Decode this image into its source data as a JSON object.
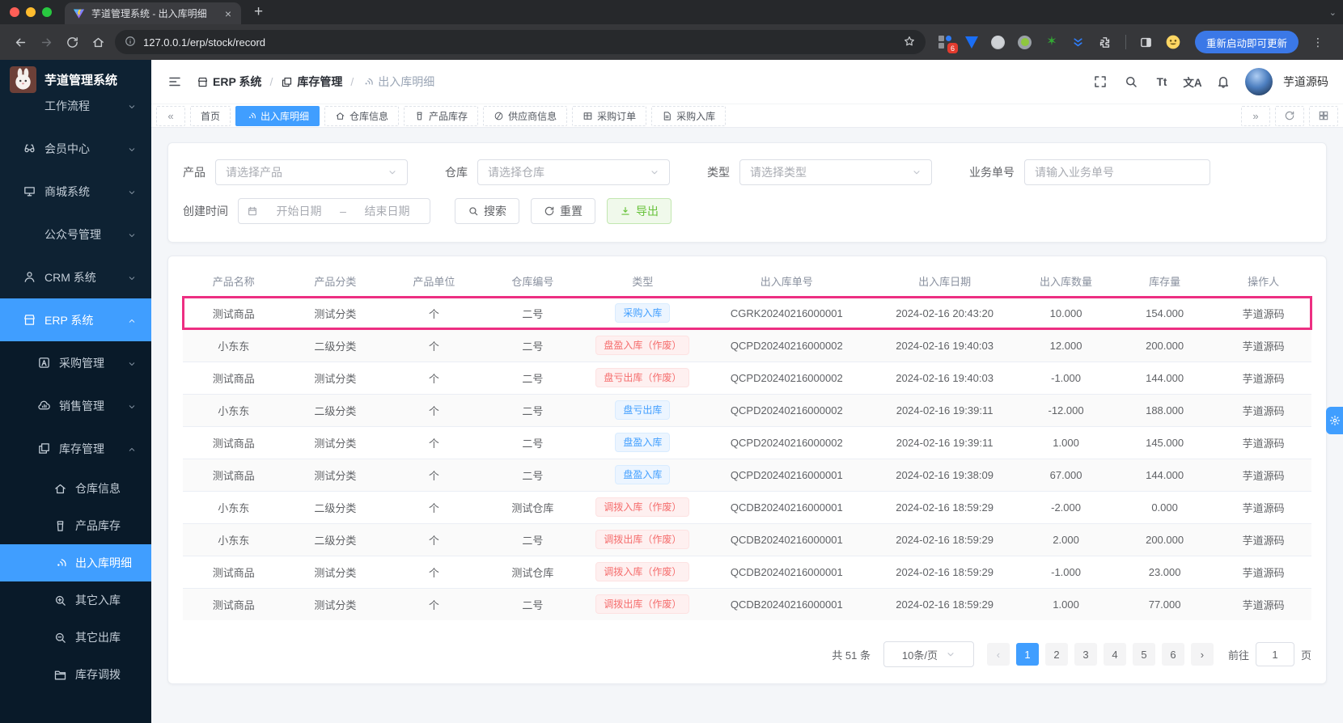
{
  "browser": {
    "tab_title": "芋道管理系统 - 出入库明细",
    "url": "127.0.0.1/erp/stock/record",
    "update_button_label": "重新启动即可更新",
    "extension_badge_count": "6"
  },
  "app_header": {
    "breadcrumb": [
      {
        "label": "ERP 系统",
        "icon": "store-icon"
      },
      {
        "label": "库存管理",
        "icon": "stock-icon"
      },
      {
        "label": "出入库明细",
        "icon": "record-icon"
      }
    ],
    "font_size_icon_text": "Tt",
    "locale_icon_text": "文A",
    "username": "芋道源码"
  },
  "tags_view": {
    "tabs": [
      {
        "label": "首页",
        "icon": null,
        "active": false
      },
      {
        "label": "出入库明细",
        "icon": "record-icon",
        "active": true
      },
      {
        "label": "仓库信息",
        "icon": "home-icon",
        "active": false
      },
      {
        "label": "产品库存",
        "icon": "cup-icon",
        "active": false
      },
      {
        "label": "供应商信息",
        "icon": "supplier-icon",
        "active": false
      },
      {
        "label": "采购订单",
        "icon": "table-icon",
        "active": false
      },
      {
        "label": "采购入库",
        "icon": "document-icon",
        "active": false
      }
    ]
  },
  "sidebar": {
    "title": "芋道管理系统",
    "items": [
      {
        "label": "工作流程",
        "level": 1,
        "chevron": "down",
        "icon": null,
        "clipped": true,
        "active": false
      },
      {
        "label": "会员中心",
        "level": 1,
        "chevron": "down",
        "icon": "member-icon",
        "active": false
      },
      {
        "label": "商城系统",
        "level": 1,
        "chevron": "down",
        "icon": "mall-icon",
        "active": false
      },
      {
        "label": "公众号管理",
        "level": 1,
        "chevron": "down",
        "icon": null,
        "active": false
      },
      {
        "label": "CRM 系统",
        "level": 1,
        "chevron": "down",
        "icon": "user-icon",
        "active": false
      },
      {
        "label": "ERP 系统",
        "level": 1,
        "chevron": "up",
        "icon": "store-icon",
        "active": true
      },
      {
        "label": "采购管理",
        "level": 2,
        "chevron": "down",
        "icon": "a-square-icon",
        "active": false
      },
      {
        "label": "销售管理",
        "level": 2,
        "chevron": "down",
        "icon": "cloud-chart-icon",
        "active": false
      },
      {
        "label": "库存管理",
        "level": 2,
        "chevron": "up",
        "icon": "stock-icon",
        "active": false
      },
      {
        "label": "仓库信息",
        "level": 3,
        "chevron": null,
        "icon": "home-icon",
        "active": false
      },
      {
        "label": "产品库存",
        "level": 3,
        "chevron": null,
        "icon": "cup-icon",
        "active": false
      },
      {
        "label": "出入库明细",
        "level": 3,
        "chevron": null,
        "icon": "record-icon",
        "active": true
      },
      {
        "label": "其它入库",
        "level": 3,
        "chevron": null,
        "icon": "zoom-in-icon",
        "active": false
      },
      {
        "label": "其它出库",
        "level": 3,
        "chevron": null,
        "icon": "zoom-out-icon",
        "active": false
      },
      {
        "label": "库存调拨",
        "level": 3,
        "chevron": null,
        "icon": "folder-icon",
        "active": false
      }
    ]
  },
  "filters": {
    "product": {
      "label": "产品",
      "placeholder": "请选择产品"
    },
    "warehouse": {
      "label": "仓库",
      "placeholder": "请选择仓库"
    },
    "type": {
      "label": "类型",
      "placeholder": "请选择类型"
    },
    "biz_no": {
      "label": "业务单号",
      "placeholder": "请输入业务单号"
    },
    "create_time": {
      "label": "创建时间",
      "start_placeholder": "开始日期",
      "separator": "–",
      "end_placeholder": "结束日期"
    },
    "search_label": "搜索",
    "reset_label": "重置",
    "export_label": "导出"
  },
  "table": {
    "columns": [
      "产品名称",
      "产品分类",
      "产品单位",
      "仓库编号",
      "类型",
      "出入库单号",
      "出入库日期",
      "出入库数量",
      "库存量",
      "操作人"
    ],
    "rows": [
      {
        "product": "测试商品",
        "category": "测试分类",
        "unit": "个",
        "warehouse": "二号",
        "type": "采购入库",
        "type_color": "blue",
        "order_no": "CGRK20240216000001",
        "datetime": "2024-02-16 20:43:20",
        "quantity": "10.000",
        "stock": "154.000",
        "operator": "芋道源码",
        "highlighted": true
      },
      {
        "product": "小东东",
        "category": "二级分类",
        "unit": "个",
        "warehouse": "二号",
        "type": "盘盈入库（作废）",
        "type_color": "red",
        "order_no": "QCPD20240216000002",
        "datetime": "2024-02-16 19:40:03",
        "quantity": "12.000",
        "stock": "200.000",
        "operator": "芋道源码",
        "highlighted": false
      },
      {
        "product": "测试商品",
        "category": "测试分类",
        "unit": "个",
        "warehouse": "二号",
        "type": "盘亏出库（作废）",
        "type_color": "red",
        "order_no": "QCPD20240216000002",
        "datetime": "2024-02-16 19:40:03",
        "quantity": "-1.000",
        "stock": "144.000",
        "operator": "芋道源码",
        "highlighted": false
      },
      {
        "product": "小东东",
        "category": "二级分类",
        "unit": "个",
        "warehouse": "二号",
        "type": "盘亏出库",
        "type_color": "blue",
        "order_no": "QCPD20240216000002",
        "datetime": "2024-02-16 19:39:11",
        "quantity": "-12.000",
        "stock": "188.000",
        "operator": "芋道源码",
        "highlighted": false
      },
      {
        "product": "测试商品",
        "category": "测试分类",
        "unit": "个",
        "warehouse": "二号",
        "type": "盘盈入库",
        "type_color": "blue",
        "order_no": "QCPD20240216000002",
        "datetime": "2024-02-16 19:39:11",
        "quantity": "1.000",
        "stock": "145.000",
        "operator": "芋道源码",
        "highlighted": false
      },
      {
        "product": "测试商品",
        "category": "测试分类",
        "unit": "个",
        "warehouse": "二号",
        "type": "盘盈入库",
        "type_color": "blue",
        "order_no": "QCPD20240216000001",
        "datetime": "2024-02-16 19:38:09",
        "quantity": "67.000",
        "stock": "144.000",
        "operator": "芋道源码",
        "highlighted": false
      },
      {
        "product": "小东东",
        "category": "二级分类",
        "unit": "个",
        "warehouse": "测试仓库",
        "type": "调拨入库（作废）",
        "type_color": "red",
        "order_no": "QCDB20240216000001",
        "datetime": "2024-02-16 18:59:29",
        "quantity": "-2.000",
        "stock": "0.000",
        "operator": "芋道源码",
        "highlighted": false
      },
      {
        "product": "小东东",
        "category": "二级分类",
        "unit": "个",
        "warehouse": "二号",
        "type": "调拨出库（作废）",
        "type_color": "red",
        "order_no": "QCDB20240216000001",
        "datetime": "2024-02-16 18:59:29",
        "quantity": "2.000",
        "stock": "200.000",
        "operator": "芋道源码",
        "highlighted": false
      },
      {
        "product": "测试商品",
        "category": "测试分类",
        "unit": "个",
        "warehouse": "测试仓库",
        "type": "调拨入库（作废）",
        "type_color": "red",
        "order_no": "QCDB20240216000001",
        "datetime": "2024-02-16 18:59:29",
        "quantity": "-1.000",
        "stock": "23.000",
        "operator": "芋道源码",
        "highlighted": false
      },
      {
        "product": "测试商品",
        "category": "测试分类",
        "unit": "个",
        "warehouse": "二号",
        "type": "调拨出库（作废）",
        "type_color": "red",
        "order_no": "QCDB20240216000001",
        "datetime": "2024-02-16 18:59:29",
        "quantity": "1.000",
        "stock": "77.000",
        "operator": "芋道源码",
        "highlighted": false
      }
    ]
  },
  "pagination": {
    "total_text": "共 51 条",
    "page_size_label": "10条/页",
    "pages": [
      "1",
      "2",
      "3",
      "4",
      "5",
      "6"
    ],
    "active_page": "1",
    "goto_label": "前往",
    "goto_value": "1",
    "goto_suffix": "页"
  },
  "colors": {
    "primary": "#409eff",
    "success": "#67c23a",
    "danger": "#f56c6c",
    "highlight_border": "#ed2f82",
    "sidebar_bg": "#0e2233",
    "sidebar_submenu_bg": "#091a29"
  },
  "icons": {
    "glyphs": {
      "collapse-left": "«",
      "expand-right": "»",
      "page-prev": "‹",
      "page-next": "›",
      "close": "×",
      "new-tab": "+",
      "overflow": "⋮",
      "tabstrip-chevron": "⌄"
    }
  }
}
